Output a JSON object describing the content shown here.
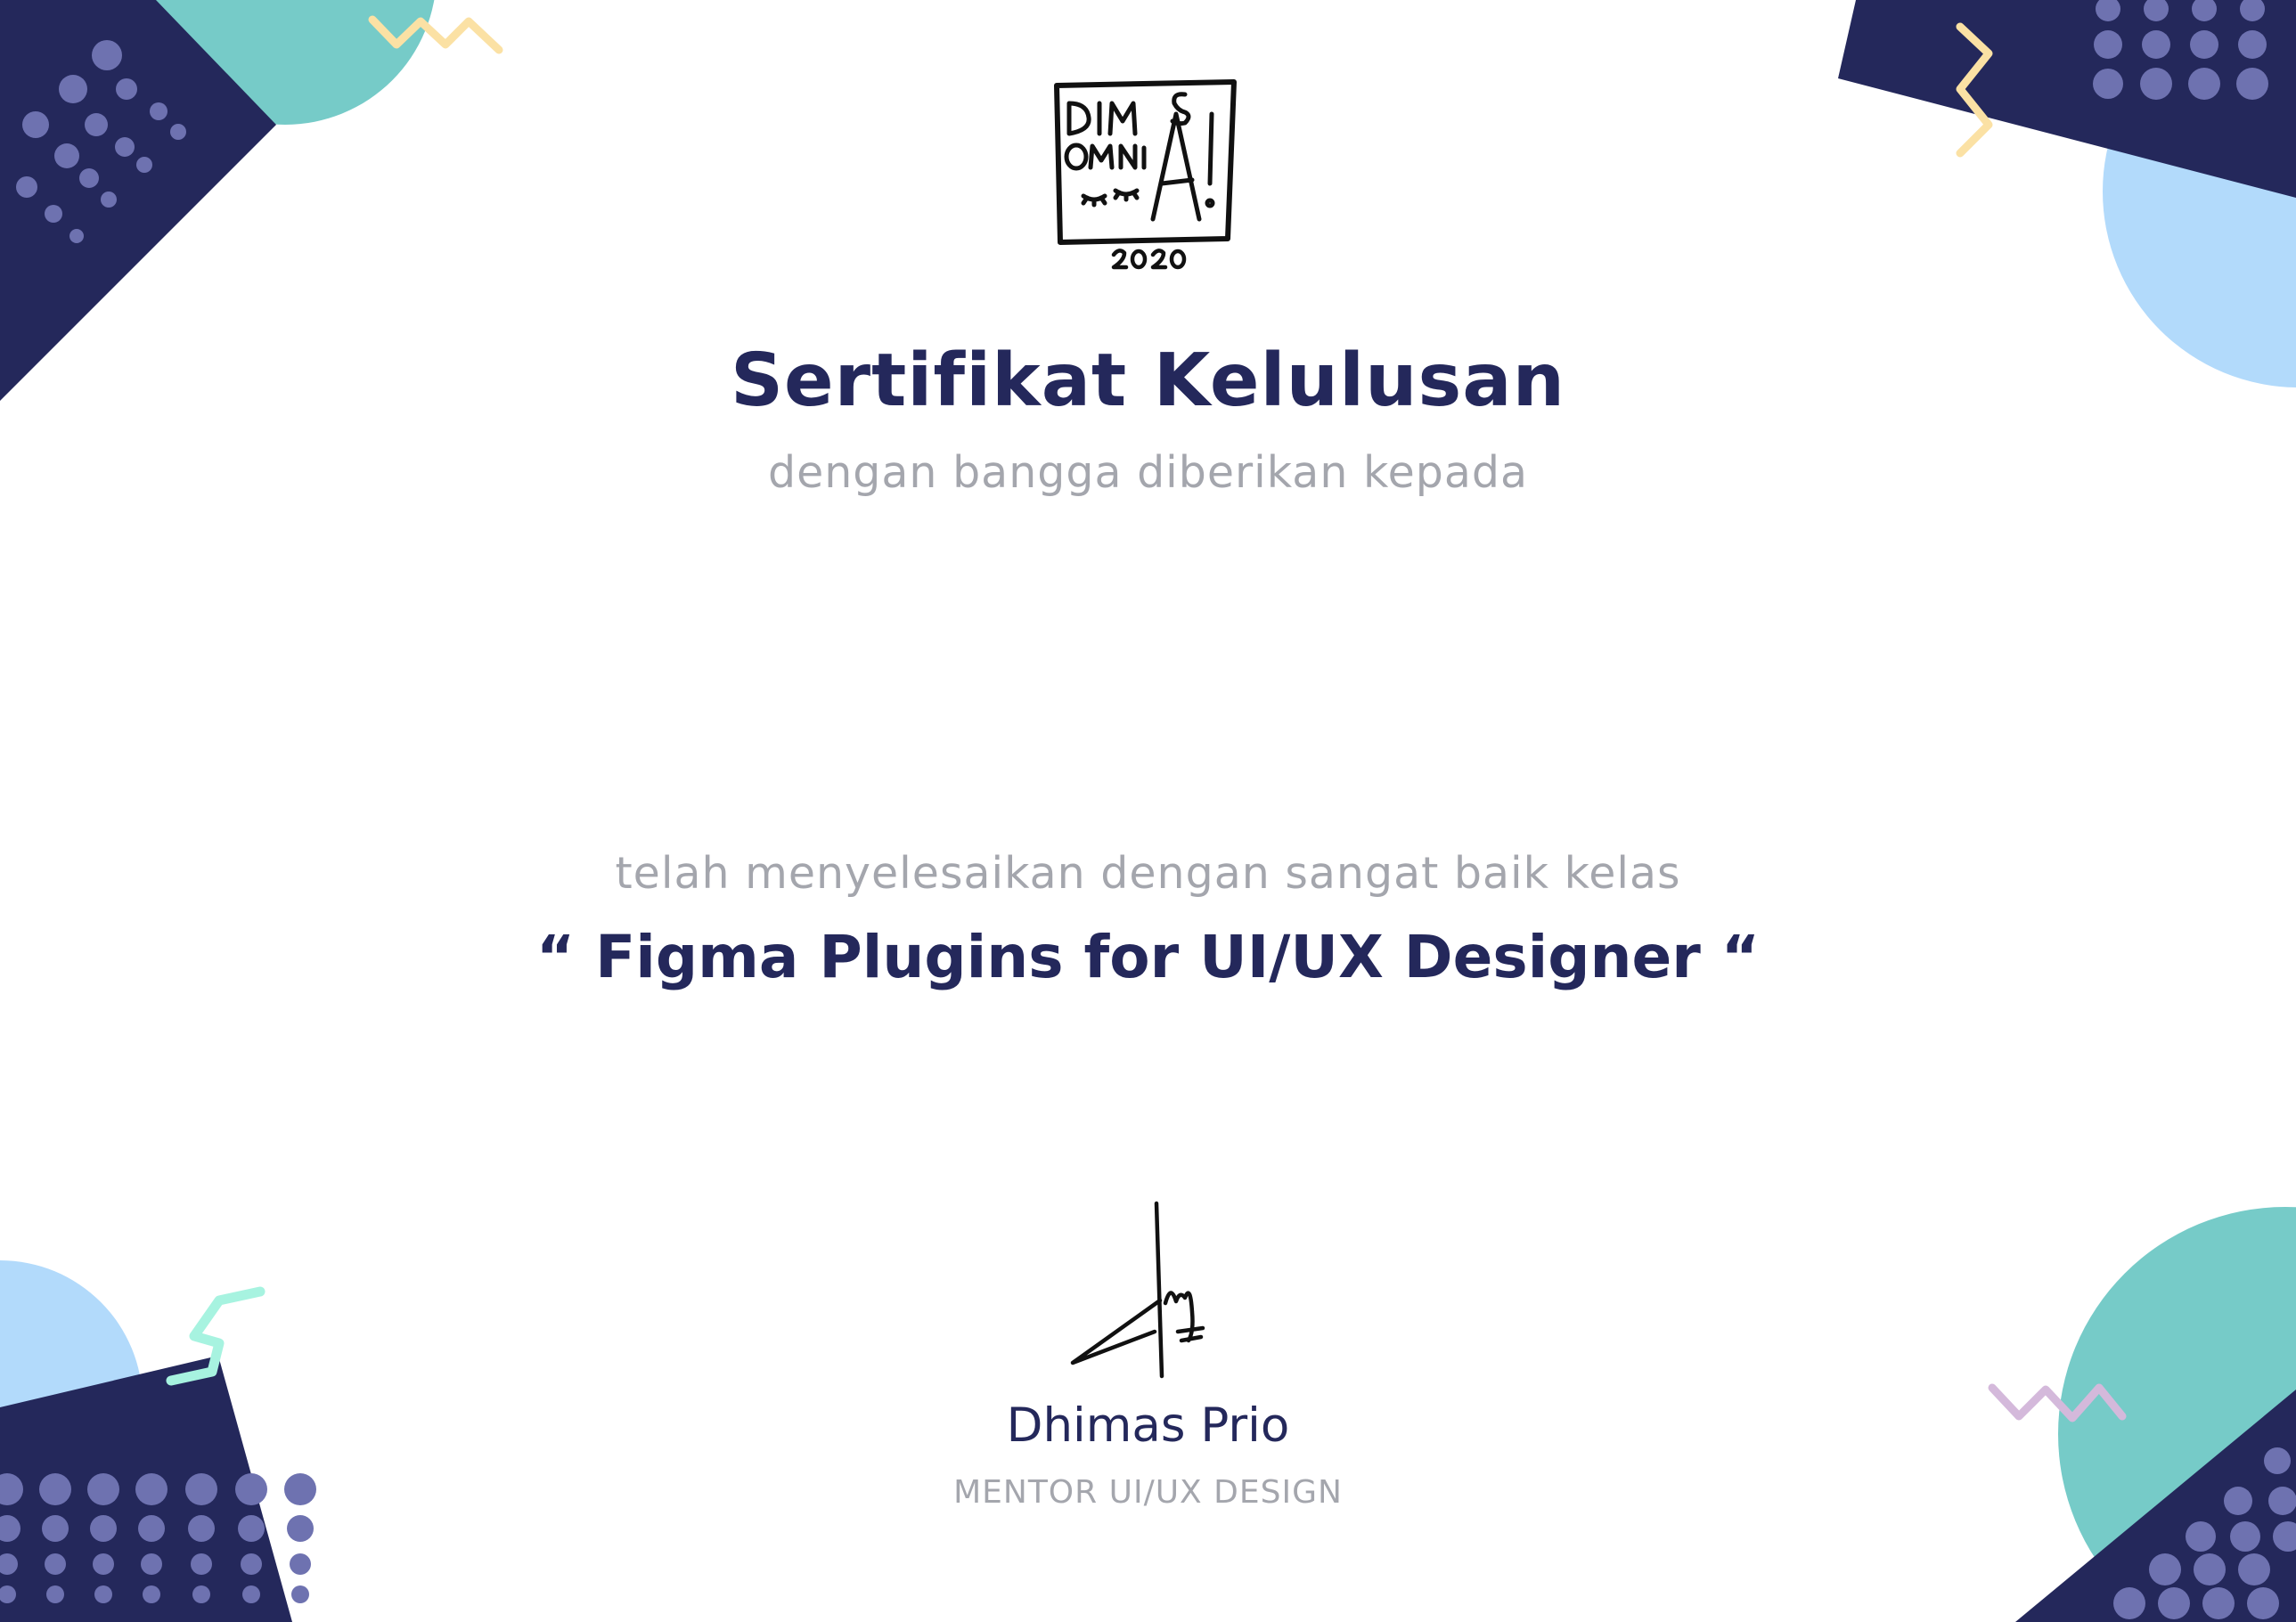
{
  "colors": {
    "navy": "#24285b",
    "teal": "#76cbc8",
    "light_blue": "#b2dafb",
    "dot_purple": "#6e72b0",
    "yellow": "#fbe1a4",
    "mint": "#a7f3e0",
    "lavender": "#d4b9db",
    "gray_text": "#a4a6ad"
  },
  "logo": {
    "lines": [
      "DIM",
      "S",
      "OMNI",
      "A!"
    ],
    "year": "2020",
    "icon": "dimas-omnia-logo-icon"
  },
  "certificate": {
    "title": "Sertifikat Kelulusan",
    "subtitle": "dengan bangga diberikan kepada",
    "completed_text": "telah menyelesaikan dengan sangat baik kelas",
    "course": "“ Figma Plugins for UI/UX Designer “"
  },
  "mentor": {
    "name": "Dhimas Prio",
    "role": "MENTOR UI/UX DESIGN"
  }
}
